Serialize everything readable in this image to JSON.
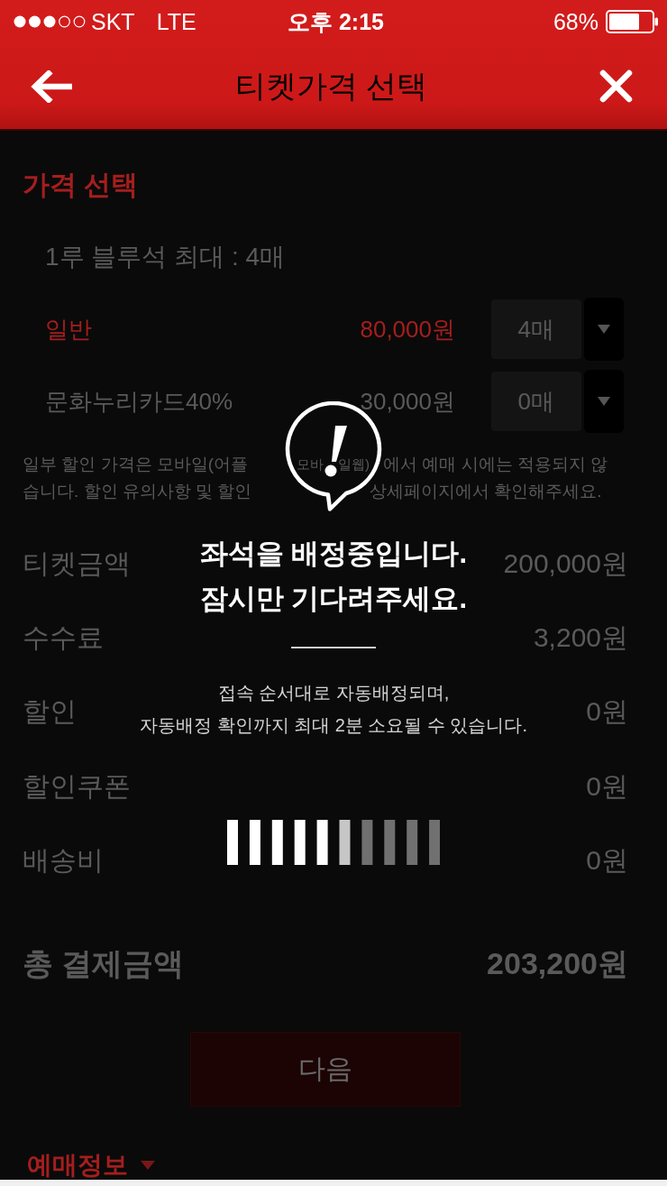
{
  "status_bar": {
    "carrier": "SKT",
    "network": "LTE",
    "time": "오후 2:15",
    "battery": "68%"
  },
  "nav_bar": {
    "title": "티켓가격 선택"
  },
  "price_selection": {
    "title": "가격 선택",
    "seat_grade": "1루 블루석 최대 : 4매",
    "prices": [
      {
        "name": "일반",
        "price": "80,000원",
        "quantity": "4매",
        "selected": true
      },
      {
        "name": "문화누리카드40%",
        "price": "30,000원",
        "quantity": "0매",
        "selected": false
      }
    ],
    "note_lines": [
      [
        "일부 할인 가격은 모바일(어플",
        "모바",
        "일웹)",
        "에서 예매 시에는 적용되지 않"
      ],
      [
        "습니다. 할인 유의사항 및 할인",
        "상세페이지에서 확인해주세요."
      ]
    ]
  },
  "summary": [
    {
      "label": "티켓금액",
      "amount": "200,000원"
    },
    {
      "label": "수수료",
      "amount": "3,200원"
    },
    {
      "label": "할인",
      "amount": "0원"
    },
    {
      "label": "할인쿠폰",
      "amount": "0원"
    },
    {
      "label": "배송비",
      "amount": "0원"
    }
  ],
  "total": {
    "label": "총 결제금액",
    "amount": "203,200원"
  },
  "next_button": "다음",
  "booking_info": {
    "label": "예매정보"
  },
  "dialog": {
    "title_lines": [
      "좌석을 배정중입니다.",
      "잠시만 기다려주세요."
    ],
    "message_lines": [
      "접속 순서대로 자동배정되며,",
      "자동배정 확인까지 최대 2분 소요될 수 있습니다."
    ]
  }
}
